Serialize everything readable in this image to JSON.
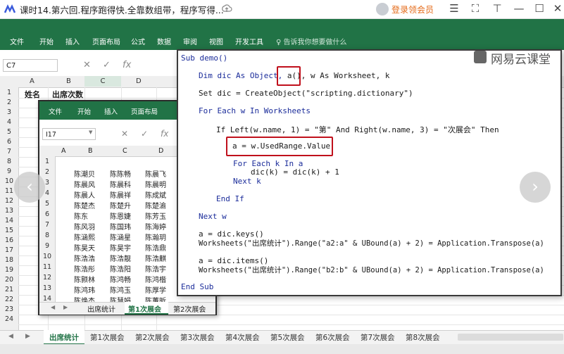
{
  "player": {
    "title": "课时14.第六回.程序跑得快.全靠数组带，程序写得...",
    "login": "登录领会员",
    "brand": "网易云课堂"
  },
  "excel": {
    "ribbon_tabs": [
      "文件",
      "开始",
      "插入",
      "页面布局",
      "公式",
      "数据",
      "审阅",
      "视图",
      "开发工具"
    ],
    "tell_me": "♀ 告诉我你想要做什么",
    "name_box": "C7",
    "columns": [
      "A",
      "B",
      "C",
      "D"
    ],
    "rows": [
      "1",
      "2",
      "3",
      "4",
      "5",
      "6",
      "7",
      "8",
      "9",
      "10",
      "11",
      "12",
      "13",
      "14",
      "15",
      "16",
      "17",
      "18",
      "19",
      "20",
      "21",
      "22",
      "23",
      "24"
    ],
    "cell_A1": "姓名",
    "cell_B1": "出席次数",
    "sheet_tabs": [
      "出席统计",
      "第1次展会",
      "第2次展会",
      "第3次展会",
      "第4次展会",
      "第5次展会",
      "第6次展会",
      "第7次展会",
      "第8次展会"
    ],
    "active_sheet": "出席统计"
  },
  "inner_excel": {
    "ribbon_tabs": [
      "文件",
      "开始",
      "插入",
      "页面布局"
    ],
    "name_box": "I17",
    "columns": [
      "A",
      "B",
      "C",
      "D"
    ],
    "rows": [
      "1",
      "2",
      "3",
      "4",
      "5",
      "6",
      "7",
      "8",
      "9",
      "10",
      "11",
      "12",
      "13",
      "14"
    ],
    "col_b": [
      "",
      "陈潮贝",
      "陈晨风",
      "陈晨人",
      "陈楚杰",
      "陈东",
      "陈风羽",
      "陈涵熙",
      "陈昊天",
      "陈浩浩",
      "陈浩彤",
      "陈颢林",
      "陈鸿玮",
      "陈焕杰"
    ],
    "col_c": [
      "",
      "陈陈畅",
      "陈晨科",
      "陈晨祥",
      "陈楚升",
      "陈恩婕",
      "陈国玮",
      "陈涵星",
      "陈昊宇",
      "陈浩靓",
      "陈浩阳",
      "陈鸿畅",
      "陈鸿玉",
      "陈慧娟"
    ],
    "col_d": [
      "",
      "陈晨飞",
      "陈晨明",
      "陈成斌",
      "陈楚渝",
      "陈芳玉",
      "陈海婷",
      "陈瀚玥",
      "陈浩鼎",
      "陈浩麒",
      "陈浩宇",
      "陈鸿楷",
      "陈厚学",
      "陈蕙昕"
    ],
    "sheet_tabs": [
      "出席统计",
      "第1次展会",
      "第2次展会"
    ],
    "active_sheet": "第1次展会"
  },
  "code": {
    "l1": "Sub demo()",
    "l2a": "Dim dic As Object, ",
    "l2b": "a()",
    "l2c": ", w As Worksheet, k",
    "l3": "Set dic = CreateObject(\"scripting.dictionary\")",
    "l4": "For Each w In Worksheets",
    "l5": "If Left(w.name, 1) = \"第\" And Right(w.name, 3) = \"次展会\" Then",
    "l6": "a = w.UsedRange.Value",
    "l7": "For Each k In a",
    "l8": "dic(k) = dic(k) + 1",
    "l9": "Next k",
    "l10": "End If",
    "l11": "Next w",
    "l12": "a = dic.keys()",
    "l13": "Worksheets(\"出席统计\").Range(\"a2:a\" & UBound(a) + 2) = Application.Transpose(a)",
    "l14": "a = dic.items()",
    "l15": "Worksheets(\"出席统计\").Range(\"b2:b\" & UBound(a) + 2) = Application.Transpose(a)",
    "l16": "End Sub"
  },
  "colors": {
    "excel_green": "#217346",
    "highlight": "#c0101c",
    "login": "#e46a18"
  },
  "icons": [
    "app-logo-icon",
    "upload-icon",
    "avatar-icon",
    "menu-icon",
    "fullscreen-icon",
    "pin-icon",
    "minimize-icon",
    "maximize-icon",
    "close-icon",
    "prev-arrow-icon",
    "next-arrow-icon"
  ]
}
